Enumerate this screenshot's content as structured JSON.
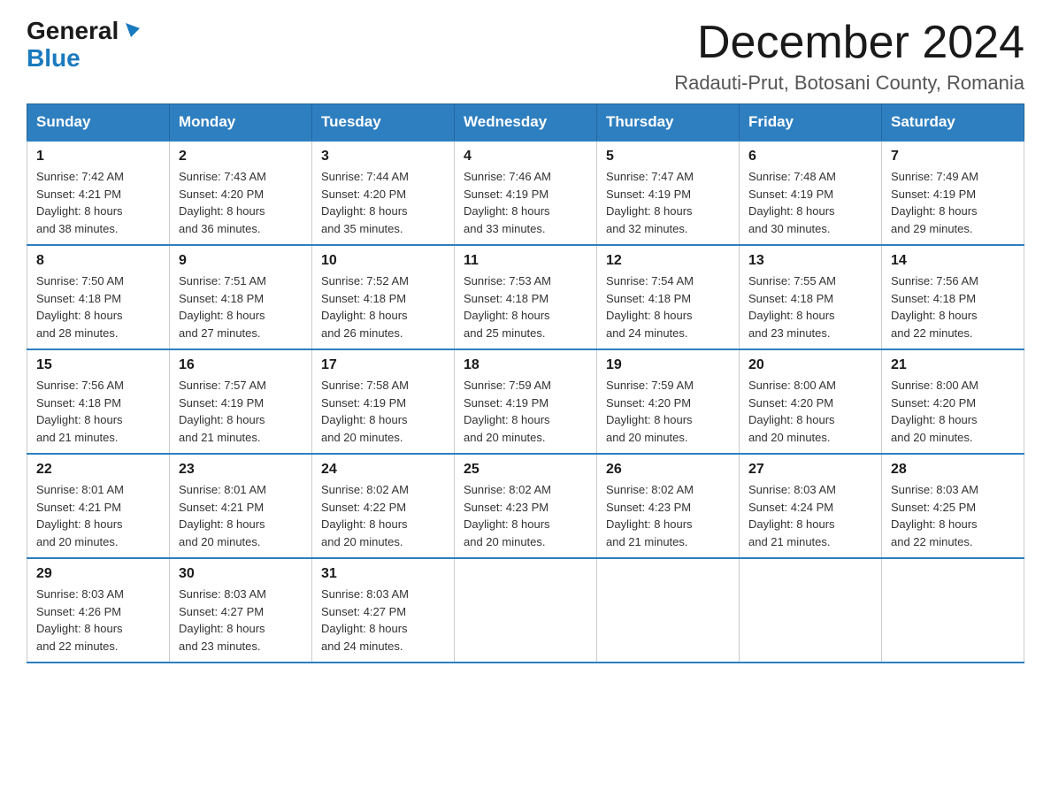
{
  "header": {
    "logo_general": "General",
    "logo_blue": "Blue",
    "month_title": "December 2024",
    "location": "Radauti-Prut, Botosani County, Romania"
  },
  "days_of_week": [
    "Sunday",
    "Monday",
    "Tuesday",
    "Wednesday",
    "Thursday",
    "Friday",
    "Saturday"
  ],
  "weeks": [
    [
      {
        "day": "1",
        "sunrise": "7:42 AM",
        "sunset": "4:21 PM",
        "daylight": "8 hours and 38 minutes."
      },
      {
        "day": "2",
        "sunrise": "7:43 AM",
        "sunset": "4:20 PM",
        "daylight": "8 hours and 36 minutes."
      },
      {
        "day": "3",
        "sunrise": "7:44 AM",
        "sunset": "4:20 PM",
        "daylight": "8 hours and 35 minutes."
      },
      {
        "day": "4",
        "sunrise": "7:46 AM",
        "sunset": "4:19 PM",
        "daylight": "8 hours and 33 minutes."
      },
      {
        "day": "5",
        "sunrise": "7:47 AM",
        "sunset": "4:19 PM",
        "daylight": "8 hours and 32 minutes."
      },
      {
        "day": "6",
        "sunrise": "7:48 AM",
        "sunset": "4:19 PM",
        "daylight": "8 hours and 30 minutes."
      },
      {
        "day": "7",
        "sunrise": "7:49 AM",
        "sunset": "4:19 PM",
        "daylight": "8 hours and 29 minutes."
      }
    ],
    [
      {
        "day": "8",
        "sunrise": "7:50 AM",
        "sunset": "4:18 PM",
        "daylight": "8 hours and 28 minutes."
      },
      {
        "day": "9",
        "sunrise": "7:51 AM",
        "sunset": "4:18 PM",
        "daylight": "8 hours and 27 minutes."
      },
      {
        "day": "10",
        "sunrise": "7:52 AM",
        "sunset": "4:18 PM",
        "daylight": "8 hours and 26 minutes."
      },
      {
        "day": "11",
        "sunrise": "7:53 AM",
        "sunset": "4:18 PM",
        "daylight": "8 hours and 25 minutes."
      },
      {
        "day": "12",
        "sunrise": "7:54 AM",
        "sunset": "4:18 PM",
        "daylight": "8 hours and 24 minutes."
      },
      {
        "day": "13",
        "sunrise": "7:55 AM",
        "sunset": "4:18 PM",
        "daylight": "8 hours and 23 minutes."
      },
      {
        "day": "14",
        "sunrise": "7:56 AM",
        "sunset": "4:18 PM",
        "daylight": "8 hours and 22 minutes."
      }
    ],
    [
      {
        "day": "15",
        "sunrise": "7:56 AM",
        "sunset": "4:18 PM",
        "daylight": "8 hours and 21 minutes."
      },
      {
        "day": "16",
        "sunrise": "7:57 AM",
        "sunset": "4:19 PM",
        "daylight": "8 hours and 21 minutes."
      },
      {
        "day": "17",
        "sunrise": "7:58 AM",
        "sunset": "4:19 PM",
        "daylight": "8 hours and 20 minutes."
      },
      {
        "day": "18",
        "sunrise": "7:59 AM",
        "sunset": "4:19 PM",
        "daylight": "8 hours and 20 minutes."
      },
      {
        "day": "19",
        "sunrise": "7:59 AM",
        "sunset": "4:20 PM",
        "daylight": "8 hours and 20 minutes."
      },
      {
        "day": "20",
        "sunrise": "8:00 AM",
        "sunset": "4:20 PM",
        "daylight": "8 hours and 20 minutes."
      },
      {
        "day": "21",
        "sunrise": "8:00 AM",
        "sunset": "4:20 PM",
        "daylight": "8 hours and 20 minutes."
      }
    ],
    [
      {
        "day": "22",
        "sunrise": "8:01 AM",
        "sunset": "4:21 PM",
        "daylight": "8 hours and 20 minutes."
      },
      {
        "day": "23",
        "sunrise": "8:01 AM",
        "sunset": "4:21 PM",
        "daylight": "8 hours and 20 minutes."
      },
      {
        "day": "24",
        "sunrise": "8:02 AM",
        "sunset": "4:22 PM",
        "daylight": "8 hours and 20 minutes."
      },
      {
        "day": "25",
        "sunrise": "8:02 AM",
        "sunset": "4:23 PM",
        "daylight": "8 hours and 20 minutes."
      },
      {
        "day": "26",
        "sunrise": "8:02 AM",
        "sunset": "4:23 PM",
        "daylight": "8 hours and 21 minutes."
      },
      {
        "day": "27",
        "sunrise": "8:03 AM",
        "sunset": "4:24 PM",
        "daylight": "8 hours and 21 minutes."
      },
      {
        "day": "28",
        "sunrise": "8:03 AM",
        "sunset": "4:25 PM",
        "daylight": "8 hours and 22 minutes."
      }
    ],
    [
      {
        "day": "29",
        "sunrise": "8:03 AM",
        "sunset": "4:26 PM",
        "daylight": "8 hours and 22 minutes."
      },
      {
        "day": "30",
        "sunrise": "8:03 AM",
        "sunset": "4:27 PM",
        "daylight": "8 hours and 23 minutes."
      },
      {
        "day": "31",
        "sunrise": "8:03 AM",
        "sunset": "4:27 PM",
        "daylight": "8 hours and 24 minutes."
      },
      null,
      null,
      null,
      null
    ]
  ],
  "labels": {
    "sunrise": "Sunrise:",
    "sunset": "Sunset:",
    "daylight": "Daylight:"
  }
}
